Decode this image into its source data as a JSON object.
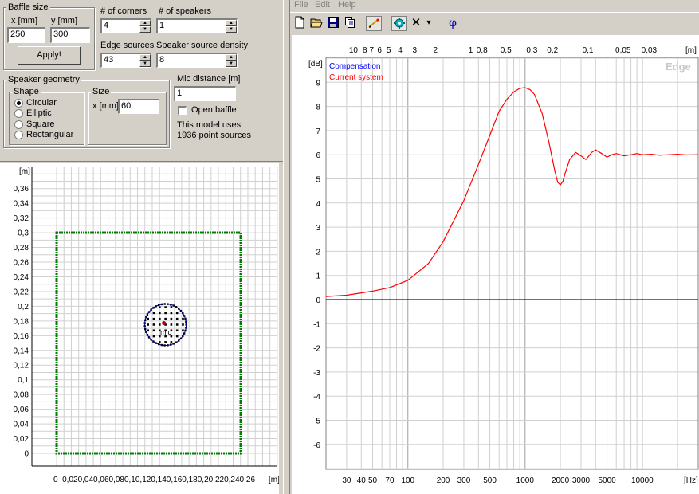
{
  "left_panel": {
    "baffle_size": {
      "title": "Baffle size",
      "x_label": "x [mm]",
      "y_label": "y [mm]",
      "x_value": "250",
      "y_value": "300",
      "apply_label": "Apply!"
    },
    "corners": {
      "label": "# of corners",
      "value": "4"
    },
    "speakers": {
      "label": "# of speakers",
      "value": "1"
    },
    "edge_sources": {
      "label": "Edge sources",
      "value": "43"
    },
    "source_density": {
      "label": "Speaker source density",
      "value": "8"
    },
    "speaker_geometry": {
      "title": "Speaker geometry",
      "shape_title": "Shape",
      "shapes": [
        {
          "label": "Circular",
          "selected": true
        },
        {
          "label": "Elliptic",
          "selected": false
        },
        {
          "label": "Square",
          "selected": false
        },
        {
          "label": "Rectangular",
          "selected": false
        }
      ],
      "size_title": "Size",
      "size_x_label": "x [mm]",
      "size_x_value": "60"
    },
    "mic_distance": {
      "label": "Mic distance [m]",
      "value": "1"
    },
    "open_baffle": {
      "label": "Open baffle",
      "checked": false
    },
    "model_info": {
      "line1": "This model uses",
      "line2": "1936 point sources"
    }
  },
  "baffle_plot": {
    "unit_label": "[m]",
    "y_ticks": [
      "0,36",
      "0,34",
      "0,32",
      "0,3",
      "0,28",
      "0,26",
      "0,24",
      "0,22",
      "0,2",
      "0,18",
      "0,16",
      "0,14",
      "0,12",
      "0,1",
      "0,08",
      "0,06",
      "0,04",
      "0,02",
      "0"
    ],
    "x_tick_text": "0  0,020,040,060,080,10,120,140,160,180,20,220,240,26",
    "x_unit": "[m]",
    "mic_label": "mic",
    "baffle_color": "#008000",
    "speaker_color": "#000080"
  },
  "menu": [
    "File",
    "Edit",
    "Help"
  ],
  "toolbar": {
    "icons": [
      "new-icon",
      "open-icon",
      "save-icon",
      "copy-icon",
      "draw-icon",
      "settings-icon",
      "delete-icon",
      "dropdown-icon",
      "phase-icon"
    ],
    "delete_glyph": "✕",
    "dropdown_glyph": "▾",
    "phase_glyph": "φ"
  },
  "chart_data": {
    "type": "line",
    "ylabel": "[dB]",
    "top_axis_unit": "[m]",
    "x_unit": "[Hz]",
    "watermark": "Edge",
    "x_scale": "log",
    "xlim": [
      20,
      30000
    ],
    "ylim": [
      -7,
      10
    ],
    "grid": true,
    "y_ticks": [
      "9",
      "8",
      "7",
      "6",
      "5",
      "4",
      "3",
      "2",
      "1",
      "0",
      "-1",
      "-2",
      "-3",
      "-4",
      "-5",
      "-6"
    ],
    "x_tick_labels": [
      {
        "v": 30,
        "t": "30"
      },
      {
        "v": 40,
        "t": "40"
      },
      {
        "v": 50,
        "t": "50"
      },
      {
        "v": 70,
        "t": "70"
      },
      {
        "v": 100,
        "t": "100"
      },
      {
        "v": 200,
        "t": "200"
      },
      {
        "v": 300,
        "t": "300"
      },
      {
        "v": 500,
        "t": "500"
      },
      {
        "v": 1000,
        "t": "1000"
      },
      {
        "v": 2000,
        "t": "2000"
      },
      {
        "v": 3000,
        "t": "3000"
      },
      {
        "v": 5000,
        "t": "5000"
      },
      {
        "v": 10000,
        "t": "10000"
      }
    ],
    "top_tick_labels": [
      {
        "v": 34.3,
        "t": "10"
      },
      {
        "v": 42.9,
        "t": "8"
      },
      {
        "v": 49,
        "t": "7"
      },
      {
        "v": 57.2,
        "t": "6"
      },
      {
        "v": 68.6,
        "t": "5"
      },
      {
        "v": 85.8,
        "t": "4"
      },
      {
        "v": 114.3,
        "t": "3"
      },
      {
        "v": 171.5,
        "t": "2"
      },
      {
        "v": 343,
        "t": "1"
      },
      {
        "v": 428.8,
        "t": "0,8"
      },
      {
        "v": 686,
        "t": "0,5"
      },
      {
        "v": 1143,
        "t": "0,3"
      },
      {
        "v": 1715,
        "t": "0,2"
      },
      {
        "v": 3430,
        "t": "0,1"
      },
      {
        "v": 6860,
        "t": "0,05"
      },
      {
        "v": 11433,
        "t": "0,03"
      }
    ],
    "legend_placement": "top-left",
    "series": [
      {
        "name": "Compensation",
        "color": "#0000ff",
        "x": [
          20,
          30000
        ],
        "y": [
          0,
          0
        ]
      },
      {
        "name": "Current system",
        "color": "#ff0000",
        "x": [
          20,
          30,
          50,
          70,
          100,
          150,
          200,
          300,
          400,
          500,
          600,
          700,
          800,
          900,
          1000,
          1100,
          1200,
          1400,
          1600,
          1800,
          1900,
          2000,
          2100,
          2200,
          2400,
          2700,
          3000,
          3300,
          3700,
          4000,
          4500,
          5000,
          5500,
          6000,
          7000,
          8000,
          9000,
          10000,
          12000,
          14000,
          17000,
          20000,
          24000,
          30000
        ],
        "y": [
          0.13,
          0.18,
          0.35,
          0.5,
          0.8,
          1.5,
          2.4,
          4.1,
          5.6,
          6.8,
          7.8,
          8.3,
          8.6,
          8.75,
          8.78,
          8.7,
          8.5,
          7.7,
          6.5,
          5.3,
          4.85,
          4.75,
          4.9,
          5.25,
          5.8,
          6.1,
          5.95,
          5.8,
          6.1,
          6.2,
          6.05,
          5.9,
          6.0,
          6.05,
          5.95,
          6.0,
          6.05,
          6.0,
          6.02,
          5.98,
          6.0,
          6.02,
          5.99,
          6.0
        ]
      }
    ]
  }
}
